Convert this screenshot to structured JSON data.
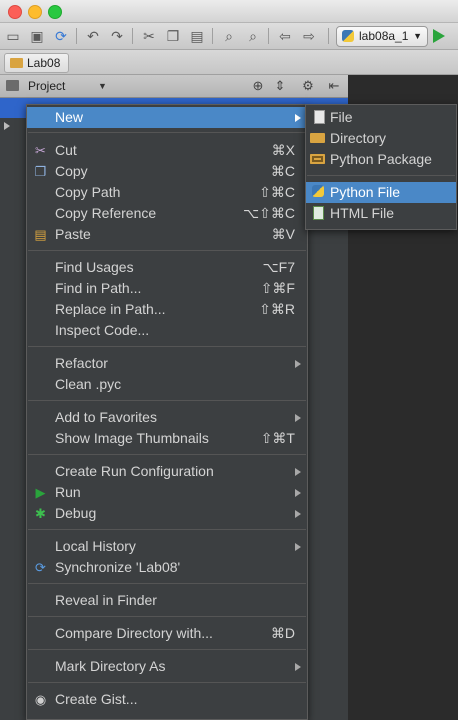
{
  "toolbar": {
    "run_config": "lab08a_1",
    "icons": [
      "folder-open-icon",
      "save-icon",
      "sync-icon",
      "undo-icon",
      "redo-icon",
      "cut-icon",
      "copy-icon",
      "paste-icon",
      "find-icon",
      "replace-icon",
      "back-icon",
      "forward-icon",
      "python-icon",
      "run-icon"
    ]
  },
  "navbar": {
    "crumb": "Lab08"
  },
  "panel": {
    "title": "Project"
  },
  "context_menu": {
    "items": [
      {
        "label": "New",
        "shortcut": "",
        "submenu": true,
        "highlighted": true
      },
      {
        "label": "Cut",
        "shortcut": "⌘X",
        "icon": "scissors-icon"
      },
      {
        "label": "Copy",
        "shortcut": "⌘C",
        "icon": "copy-icon"
      },
      {
        "label": "Copy Path",
        "shortcut": "⇧⌘C"
      },
      {
        "label": "Copy Reference",
        "shortcut": "⌥⇧⌘C"
      },
      {
        "label": "Paste",
        "shortcut": "⌘V",
        "icon": "paste-icon"
      },
      {
        "label": "Find Usages",
        "shortcut": "⌥F7"
      },
      {
        "label": "Find in Path...",
        "shortcut": "⇧⌘F"
      },
      {
        "label": "Replace in Path...",
        "shortcut": "⇧⌘R"
      },
      {
        "label": "Inspect Code..."
      },
      {
        "label": "Refactor",
        "submenu": true
      },
      {
        "label": "Clean .pyc"
      },
      {
        "label": "Add to Favorites",
        "submenu": true
      },
      {
        "label": "Show Image Thumbnails",
        "shortcut": "⇧⌘T"
      },
      {
        "label": "Create Run Configuration",
        "submenu": true
      },
      {
        "label": "Run",
        "submenu": true,
        "icon": "run-icon"
      },
      {
        "label": "Debug",
        "submenu": true,
        "icon": "bug-icon"
      },
      {
        "label": "Local History",
        "submenu": true
      },
      {
        "label": "Synchronize 'Lab08'",
        "icon": "sync-icon"
      },
      {
        "label": "Reveal in Finder"
      },
      {
        "label": "Compare Directory with...",
        "shortcut": "⌘D"
      },
      {
        "label": "Mark Directory As",
        "submenu": true
      },
      {
        "label": "Create Gist...",
        "icon": "github-icon"
      }
    ]
  },
  "new_submenu": {
    "items": [
      {
        "label": "File",
        "icon": "file-icon"
      },
      {
        "label": "Directory",
        "icon": "folder-icon"
      },
      {
        "label": "Python Package",
        "icon": "package-icon"
      },
      {
        "label": "Python File",
        "icon": "python-file-icon",
        "highlighted": true
      },
      {
        "label": "HTML File",
        "icon": "html-file-icon"
      }
    ]
  },
  "colors": {
    "menu_bg": "#3c3f41",
    "highlight": "#4a88c7",
    "editor_bg": "#2b2b2b"
  }
}
